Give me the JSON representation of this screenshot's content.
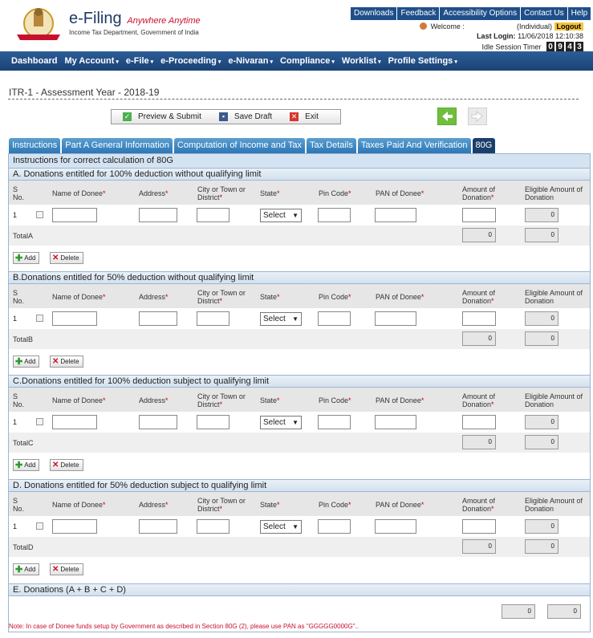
{
  "header": {
    "brand_title": "e-Filing",
    "brand_tagline": "Anywhere Anytime",
    "department": "Income Tax Department, Government of India",
    "top_links": [
      "Downloads",
      "Feedback",
      "Accessibility Options",
      "Contact Us",
      "Help"
    ],
    "welcome_label": "Welcome :",
    "user_type": "(Individual)",
    "logout_label": "Logout",
    "last_login_label": "Last Login:",
    "last_login_value": "11/06/2018 12:10:38",
    "idle_label": "Idle Session Timer",
    "timer_digits": [
      "0",
      "9",
      "4",
      "3"
    ]
  },
  "nav": {
    "items": [
      "Dashboard",
      "My Account",
      "e-File",
      "e-Proceeding",
      "e-Nivaran",
      "Compliance",
      "Worklist",
      "Profile Settings"
    ]
  },
  "page": {
    "title": "ITR-1 - Assessment Year - 2018-19"
  },
  "toolbar": {
    "preview_submit": "Preview & Submit",
    "save_draft": "Save Draft",
    "exit": "Exit"
  },
  "tabs": [
    "Instructions",
    "Part A General Information",
    "Computation of Income and Tax",
    "Tax Details",
    "Taxes Paid And Verification",
    "80G"
  ],
  "active_tab": "80G",
  "instructions_label": "Instructions for correct calculation of 80G",
  "columns": {
    "sno": "S No.",
    "name_of_donee": "Name of Donee",
    "address": "Address",
    "city": "City or Town or District",
    "state": "State",
    "pin_code": "Pin Code",
    "pan_of_donee": "PAN of Donee",
    "amount_of_donation": "Amount of Donation",
    "eligible_amount": "Eligible Amount of Donation",
    "required_marker": "*"
  },
  "sections": [
    {
      "heading": "A. Donations entitled for 100% deduction without qualifying limit",
      "row_sno": "1",
      "state_value": "Select",
      "total_label": "TotalA",
      "total_amount": "0",
      "total_eligible": "0",
      "row_eligible": "0"
    },
    {
      "heading": "B.Donations entitled for 50% deduction without qualifying limit",
      "row_sno": "1",
      "state_value": "Select",
      "total_label": "TotalB",
      "total_amount": "0",
      "total_eligible": "0",
      "row_eligible": "0"
    },
    {
      "heading": "C.Donations entitled for 100% deduction subject to qualifying limit",
      "row_sno": "1",
      "state_value": "Select",
      "total_label": "TotalC",
      "total_amount": "0",
      "total_eligible": "0",
      "row_eligible": "0"
    },
    {
      "heading": "D. Donations entitled for 50% deduction subject to qualifying limit",
      "row_sno": "1",
      "state_value": "Select",
      "total_label": "TotalD",
      "total_amount": "0",
      "total_eligible": "0",
      "row_eligible": "0"
    }
  ],
  "buttons": {
    "add": "Add",
    "delete": "Delete"
  },
  "section_e": {
    "heading": "E. Donations (A + B + C + D)",
    "total_amount": "0",
    "total_eligible": "0"
  },
  "note": "Note:   In case of Donee funds setup by Government as described in Section 80G (2), please use PAN as \"GGGGG0000G\"..",
  "colors": {
    "nav": "#1f4f8a",
    "active_tab": "#1b3f6b",
    "tab": "#2d76b6",
    "logout": "#f4c33a"
  }
}
